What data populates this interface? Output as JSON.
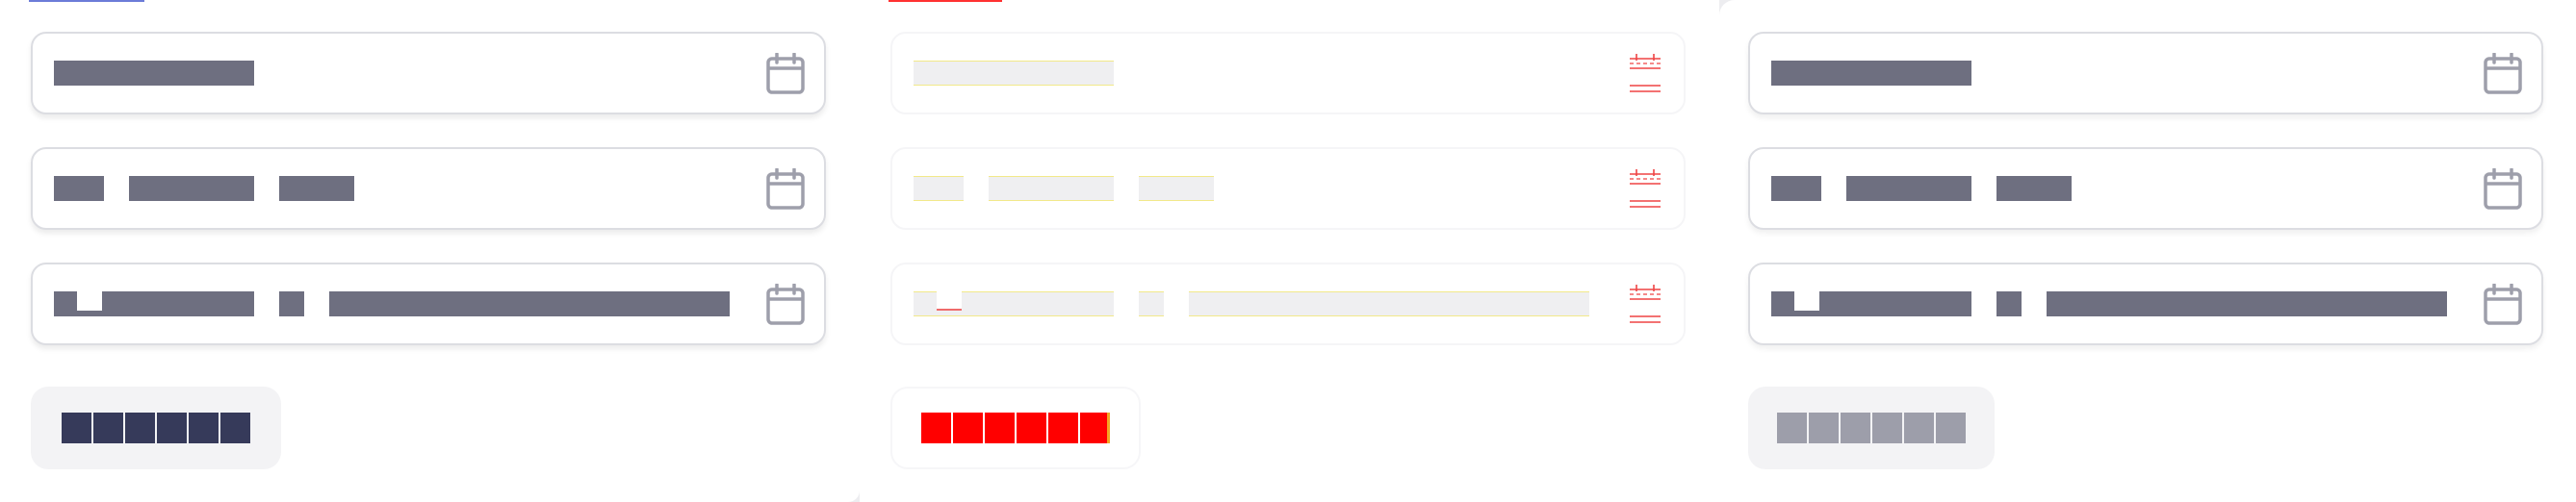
{
  "panels": [
    {
      "id": "default",
      "theme": "normal",
      "accent": "#6c7cd8",
      "segment_color": "#6e6f80",
      "chip_color": "#363a5a",
      "chip_bg": "#f3f3f5"
    },
    {
      "id": "debug",
      "theme": "outline-debug",
      "accent": "#ff3131",
      "segment_color": "#efeff1",
      "chip_color": "#ff0000",
      "chip_bg": "#ffffff"
    },
    {
      "id": "disabled",
      "theme": "muted",
      "accent": "",
      "segment_color": "#6e6f80",
      "chip_color": "#9d9eaa",
      "chip_bg": "#f3f3f5"
    }
  ],
  "fields": [
    {
      "name": "date-field",
      "icon": "calendar-icon"
    },
    {
      "name": "date-range-field",
      "icon": "calendar-icon"
    },
    {
      "name": "date-time-field",
      "icon": "calendar-icon"
    }
  ],
  "chip_cell_count": 6,
  "icon_colors": {
    "normal": "#9e9fab",
    "debug": "#ef4444"
  }
}
